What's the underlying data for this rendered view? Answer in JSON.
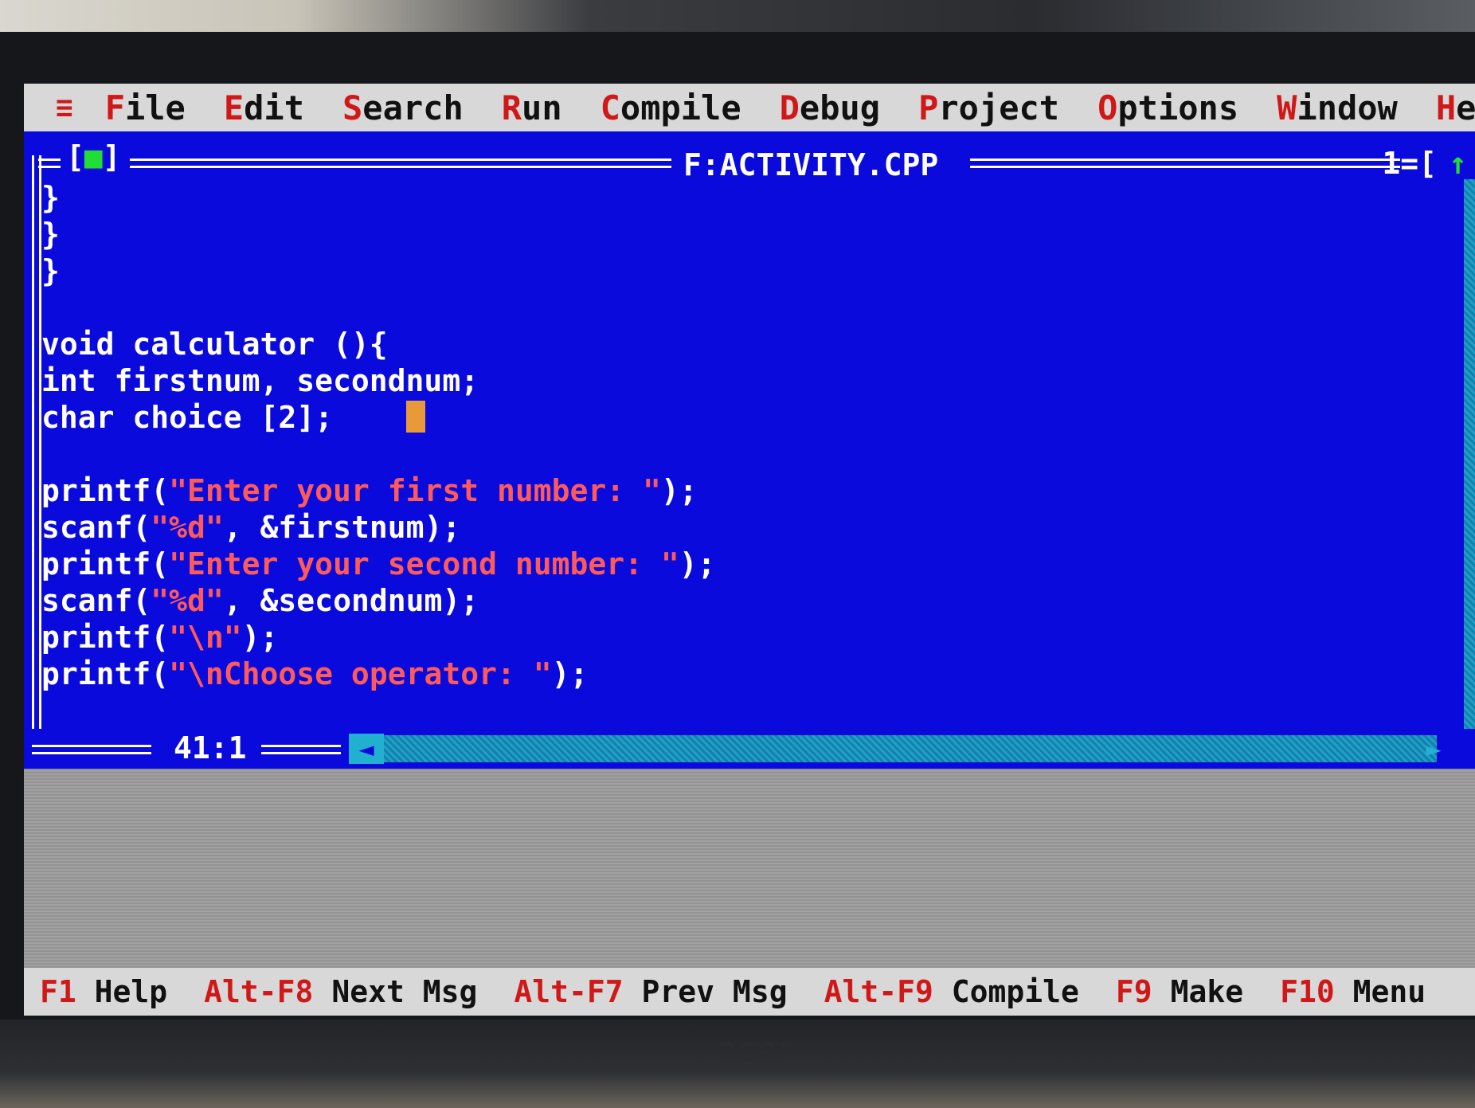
{
  "menu": {
    "system_icon": "≡",
    "items": [
      {
        "hot": "F",
        "rest": "ile"
      },
      {
        "hot": "E",
        "rest": "dit"
      },
      {
        "hot": "S",
        "rest": "earch"
      },
      {
        "hot": "R",
        "rest": "un"
      },
      {
        "hot": "C",
        "rest": "ompile"
      },
      {
        "hot": "D",
        "rest": "ebug"
      },
      {
        "hot": "P",
        "rest": "roject"
      },
      {
        "hot": "O",
        "rest": "ptions"
      },
      {
        "hot": "W",
        "rest": "indow"
      },
      {
        "hot": "H",
        "rest": "el"
      }
    ]
  },
  "editor": {
    "close_box_left": "[",
    "close_box_mark": "■",
    "close_box_right": "]",
    "title": "F:ACTIVITY.CPP",
    "window_number": "1=[",
    "zoom_icon": "↑",
    "cursor_position": "41:1",
    "code_lines": [
      {
        "parts": [
          {
            "t": "}",
            "c": "plain"
          }
        ]
      },
      {
        "parts": [
          {
            "t": "}",
            "c": "plain"
          }
        ]
      },
      {
        "parts": [
          {
            "t": "}",
            "c": "plain"
          }
        ]
      },
      {
        "parts": [
          {
            "t": "",
            "c": "plain"
          }
        ]
      },
      {
        "parts": [
          {
            "t": "void calculator (){",
            "c": "plain"
          }
        ]
      },
      {
        "parts": [
          {
            "t": "int firstnum, secondnum;",
            "c": "plain"
          }
        ]
      },
      {
        "parts": [
          {
            "t": "char choice [2];    ",
            "c": "plain"
          },
          {
            "t": "",
            "c": "cursor"
          }
        ]
      },
      {
        "parts": [
          {
            "t": "",
            "c": "plain"
          }
        ]
      },
      {
        "parts": [
          {
            "t": "printf(",
            "c": "plain"
          },
          {
            "t": "\"Enter your first number: \"",
            "c": "str"
          },
          {
            "t": ");",
            "c": "plain"
          }
        ]
      },
      {
        "parts": [
          {
            "t": "scanf(",
            "c": "plain"
          },
          {
            "t": "\"%d\"",
            "c": "str"
          },
          {
            "t": ", &firstnum);",
            "c": "plain"
          }
        ]
      },
      {
        "parts": [
          {
            "t": "printf(",
            "c": "plain"
          },
          {
            "t": "\"Enter your second number: \"",
            "c": "str"
          },
          {
            "t": ");",
            "c": "plain"
          }
        ]
      },
      {
        "parts": [
          {
            "t": "scanf(",
            "c": "plain"
          },
          {
            "t": "\"%d\"",
            "c": "str"
          },
          {
            "t": ", &secondnum);",
            "c": "plain"
          }
        ]
      },
      {
        "parts": [
          {
            "t": "printf(",
            "c": "plain"
          },
          {
            "t": "\"\\n\"",
            "c": "str"
          },
          {
            "t": ");",
            "c": "plain"
          }
        ]
      },
      {
        "parts": [
          {
            "t": "printf(",
            "c": "plain"
          },
          {
            "t": "\"\\nChoose operator: \"",
            "c": "str"
          },
          {
            "t": ");",
            "c": "plain"
          }
        ]
      }
    ]
  },
  "status": {
    "items": [
      {
        "key": "F1",
        "label": "Help"
      },
      {
        "key": "Alt-F8",
        "label": "Next Msg"
      },
      {
        "key": "Alt-F7",
        "label": "Prev Msg"
      },
      {
        "key": "Alt-F9",
        "label": "Compile"
      },
      {
        "key": "F9",
        "label": "Make"
      },
      {
        "key": "F10",
        "label": "Menu"
      }
    ]
  },
  "monitor": {
    "brand": "acer"
  },
  "colors": {
    "editor_bg": "#0a0adc",
    "hotkey": "#d01818",
    "string": "#ff5a5a",
    "cursor": "#e89a3a",
    "scrollbar": "#1ea0c8"
  }
}
